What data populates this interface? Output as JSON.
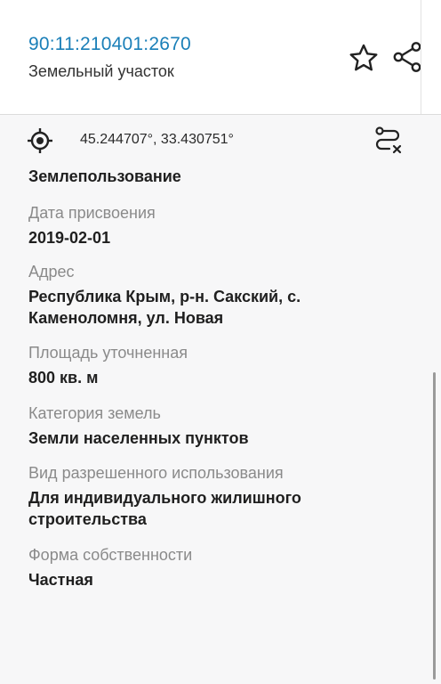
{
  "header": {
    "cadastral_number": "90:11:210401:2670",
    "object_type": "Земельный участок",
    "favorite_icon": "star-outline-icon",
    "share_icon": "share-icon",
    "accent_color": "#1a7fb8"
  },
  "location_bar": {
    "locate_icon": "gps-target-icon",
    "coordinates": "45.244707°, 33.430751°",
    "route_icon": "route-clear-icon"
  },
  "properties": {
    "partial_value": "Землепользование",
    "assign_date": {
      "label": "Дата присвоения",
      "value": "2019-02-01"
    },
    "address": {
      "label": "Адрес",
      "value_line1": "Республика Крым, р-н. Сакский, с.",
      "value_line2": "Каменоломня, ул. Новая"
    },
    "area": {
      "label": "Площадь уточненная",
      "value": "800 кв. м"
    },
    "land_category": {
      "label": "Категория земель",
      "value": "Земли населенных пунктов"
    },
    "permitted_use": {
      "label": "Вид разрешенного использования",
      "value_line1": "Для индивидуального жилишного",
      "value_line2": "строительства"
    },
    "ownership": {
      "label": "Форма собственности",
      "value": "Частная"
    }
  }
}
